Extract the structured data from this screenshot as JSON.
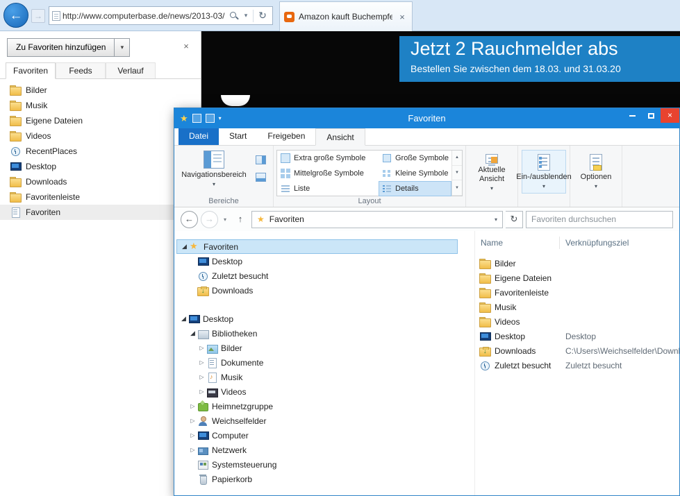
{
  "icons": {
    "back": "←",
    "forward": "→",
    "up": "↑",
    "refresh": "↻",
    "dropdown": "▾",
    "close": "×",
    "star": "★",
    "collapsed": "▷",
    "expanded": "◢",
    "scroll_up": "▲",
    "scroll_down": "▼",
    "gallery_more": "▼"
  },
  "browser": {
    "address_url": "http://www.computerbase.de/news/2013-03/",
    "tab_title": "Amazon kauft Buchempfeh...",
    "favorites_panel": {
      "add_button": "Zu Favoriten hinzufügen",
      "tabs": [
        {
          "label": "Favoriten"
        },
        {
          "label": "Feeds"
        },
        {
          "label": "Verlauf"
        }
      ],
      "items": [
        {
          "label": "Bilder"
        },
        {
          "label": "Musik"
        },
        {
          "label": "Eigene Dateien"
        },
        {
          "label": "Videos"
        },
        {
          "label": "RecentPlaces"
        },
        {
          "label": "Desktop"
        },
        {
          "label": "Downloads"
        },
        {
          "label": "Favoritenleiste"
        },
        {
          "label": "Favoriten"
        }
      ]
    },
    "page_banner": {
      "line1": "Jetzt 2 Rauchmelder abs",
      "line2": "Bestellen Sie zwischen dem 18.03. und 31.03.20"
    }
  },
  "explorer": {
    "title": "Favoriten",
    "ribbon_tabs": [
      {
        "label": "Datei"
      },
      {
        "label": "Start"
      },
      {
        "label": "Freigeben"
      },
      {
        "label": "Ansicht"
      }
    ],
    "ribbon": {
      "nav_pane": "Navigationsbereich",
      "group_bereiche": "Bereiche",
      "group_layout": "Layout",
      "layout_options": [
        {
          "label": "Extra große Symbole"
        },
        {
          "label": "Große Symbole"
        },
        {
          "label": "Mittelgroße Symbole"
        },
        {
          "label": "Kleine Symbole"
        },
        {
          "label": "Liste"
        },
        {
          "label": "Details"
        }
      ],
      "selected_layout": "Details",
      "current_view": "Aktuelle Ansicht",
      "show_hide": "Ein-/ausblenden",
      "options": "Optionen"
    },
    "address": {
      "breadcrumb": "Favoriten",
      "search_placeholder": "Favoriten durchsuchen"
    },
    "tree": [
      {
        "label": "Favoriten"
      },
      {
        "label": "Desktop"
      },
      {
        "label": "Zuletzt besucht"
      },
      {
        "label": "Downloads"
      },
      {
        "label": "Desktop"
      },
      {
        "label": "Bibliotheken"
      },
      {
        "label": "Bilder"
      },
      {
        "label": "Dokumente"
      },
      {
        "label": "Musik"
      },
      {
        "label": "Videos"
      },
      {
        "label": "Heimnetzgruppe"
      },
      {
        "label": "Weichselfelder"
      },
      {
        "label": "Computer"
      },
      {
        "label": "Netzwerk"
      },
      {
        "label": "Systemsteuerung"
      },
      {
        "label": "Papierkorb"
      }
    ],
    "columns": [
      {
        "label": "Name"
      },
      {
        "label": "Verknüpfungsziel"
      }
    ],
    "files": [
      {
        "name": "Bilder",
        "target": ""
      },
      {
        "name": "Eigene Dateien",
        "target": ""
      },
      {
        "name": "Favoritenleiste",
        "target": ""
      },
      {
        "name": "Musik",
        "target": ""
      },
      {
        "name": "Videos",
        "target": ""
      },
      {
        "name": "Desktop",
        "target": "Desktop"
      },
      {
        "name": "Downloads",
        "target": "C:\\Users\\Weichselfelder\\Download..."
      },
      {
        "name": "Zuletzt besucht",
        "target": "Zuletzt besucht"
      }
    ]
  }
}
